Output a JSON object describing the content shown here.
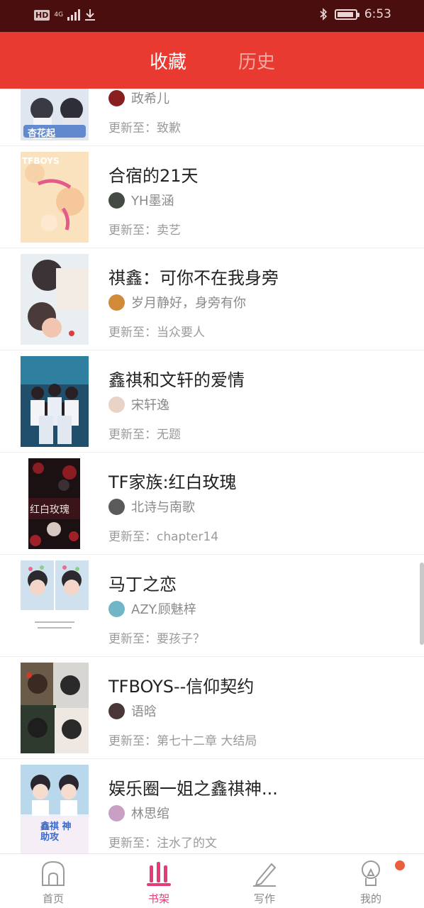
{
  "status_bar": {
    "network": "4G",
    "time": "6:53",
    "hd_label": "HD"
  },
  "tabs": [
    {
      "label": "收藏",
      "active": true
    },
    {
      "label": "历史",
      "active": false
    }
  ],
  "books": [
    {
      "title": "",
      "author": "政希儿",
      "update": "更新至：致歉",
      "cover_text": "杏花起"
    },
    {
      "title": "合宿的21天",
      "author": "YH墨涵",
      "update": "更新至：卖艺",
      "cover_text": "TFBOYS"
    },
    {
      "title": "祺鑫：可你不在我身旁",
      "author": "岁月静好，身旁有你",
      "update": "更新至：当众要人",
      "cover_text": ""
    },
    {
      "title": "鑫祺和文轩的爱情",
      "author": "宋轩逸",
      "update": "更新至：无题",
      "cover_text": ""
    },
    {
      "title": "TF家族:红白玫瑰",
      "author": "北诗与南歌",
      "update": "更新至：chapter14",
      "cover_text": "红白玫瑰"
    },
    {
      "title": "马丁之恋",
      "author": "AZY.顾魅梓",
      "update": "更新至：要孩子？",
      "cover_text": ""
    },
    {
      "title": "TFBOYS--信仰契约",
      "author": "语晗",
      "update": "更新至：第七十二章 大结局",
      "cover_text": ""
    },
    {
      "title": "娱乐圈一姐之鑫祺神...",
      "author": "林思绾",
      "update": "更新至：注水了的文",
      "cover_text": "鑫祺 神助攻"
    }
  ],
  "bottom_nav": [
    {
      "label": "首页",
      "icon": "home-icon",
      "active": false
    },
    {
      "label": "书架",
      "icon": "bookshelf-icon",
      "active": true
    },
    {
      "label": "写作",
      "icon": "pencil-icon",
      "active": false
    },
    {
      "label": "我的",
      "icon": "profile-icon",
      "active": false
    }
  ],
  "colors": {
    "accent": "#e83a30",
    "active_nav": "#e83a7a",
    "status_bar": "#4a0e0e"
  }
}
